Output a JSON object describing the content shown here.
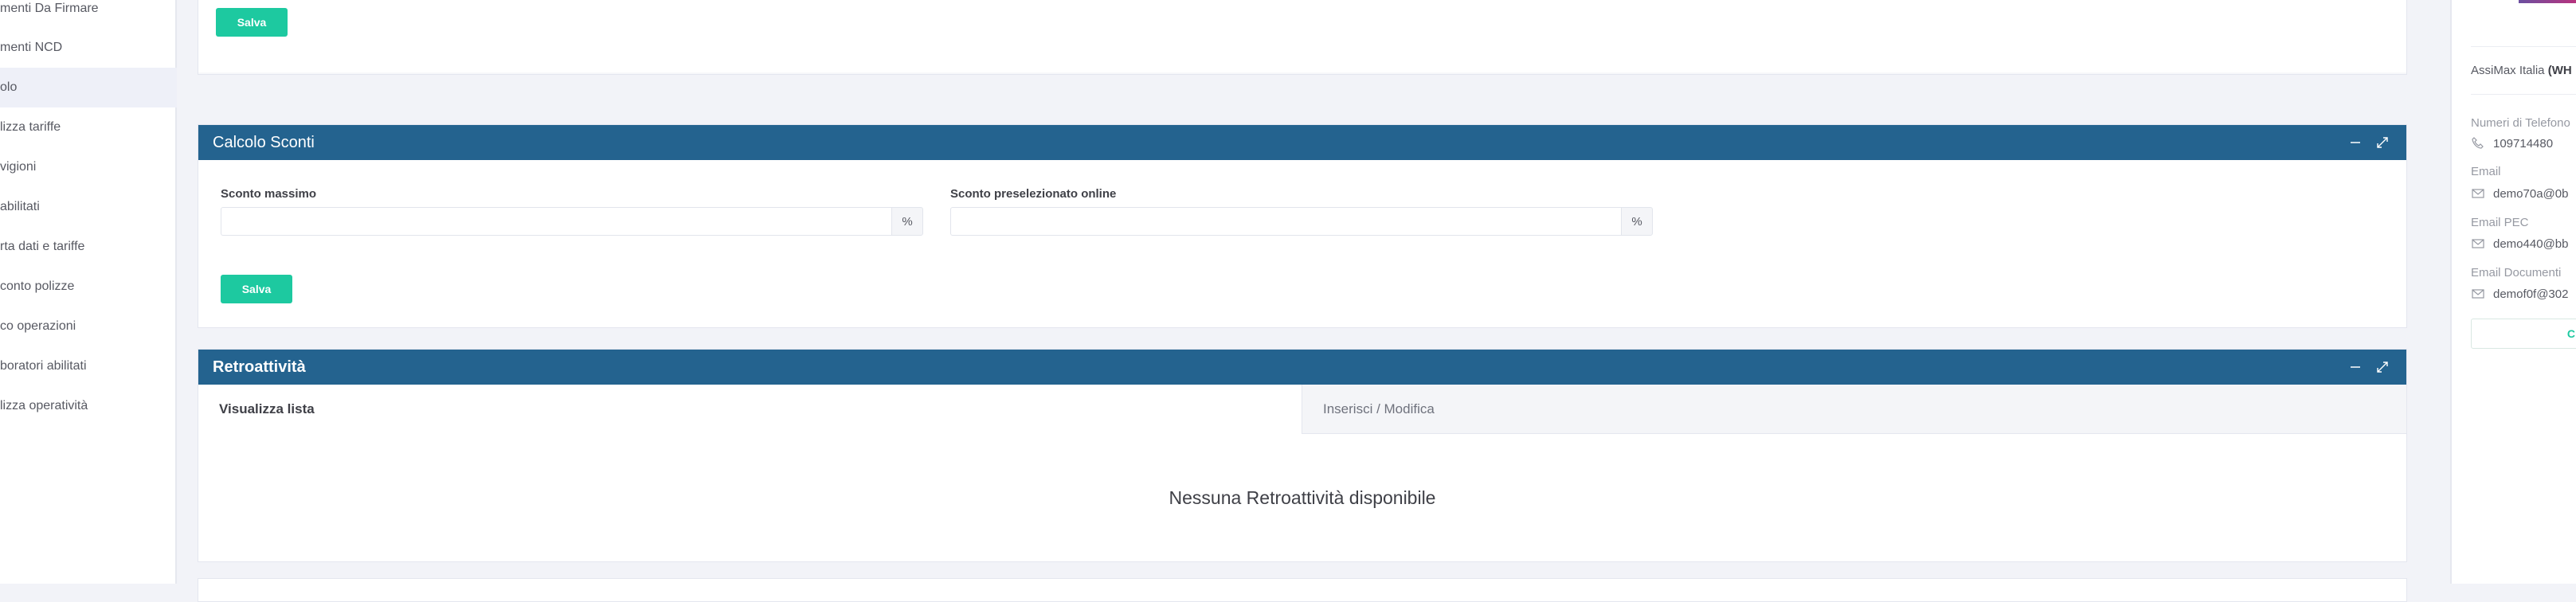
{
  "sidebar": {
    "items": [
      {
        "label": "menti Da Firmare"
      },
      {
        "label": "menti NCD"
      },
      {
        "label": "olo"
      },
      {
        "label": "lizza tariffe"
      },
      {
        "label": "vigioni"
      },
      {
        "label": " abilitati"
      },
      {
        "label": "rta dati e tariffe"
      },
      {
        "label": "conto polizze"
      },
      {
        "label": "co operazioni"
      },
      {
        "label": "boratori abilitati"
      },
      {
        "label": "lizza operatività"
      }
    ]
  },
  "top_card": {
    "save_label": "Salva"
  },
  "calcolo_sconti": {
    "title": "Calcolo Sconti",
    "field1_label": "Sconto massimo",
    "field1_value": "",
    "field1_addon": "%",
    "field2_label": "Sconto preselezionato online",
    "field2_value": "",
    "field2_addon": "%",
    "save_label": "Salva"
  },
  "retroattivita": {
    "title": "Retroattività",
    "tabs": [
      {
        "label": "Visualizza lista"
      },
      {
        "label": "Inserisci / Modifica"
      }
    ],
    "empty_message": "Nessuna Retroattività disponibile"
  },
  "right_panel": {
    "company_prefix": "AssiMax Italia ",
    "company_code": "(WH",
    "phone_label": "Numeri di Telefono",
    "phone_value": "109714480",
    "email_label": "Email",
    "email_value": "demo70a@0b",
    "pec_label": "Email PEC",
    "pec_value": "demo440@bb",
    "docs_label": "Email Documenti",
    "docs_value": "demof0f@302",
    "button_label": "C"
  },
  "colors": {
    "header_blue": "#24638f",
    "save_green": "#1dc9a0"
  }
}
